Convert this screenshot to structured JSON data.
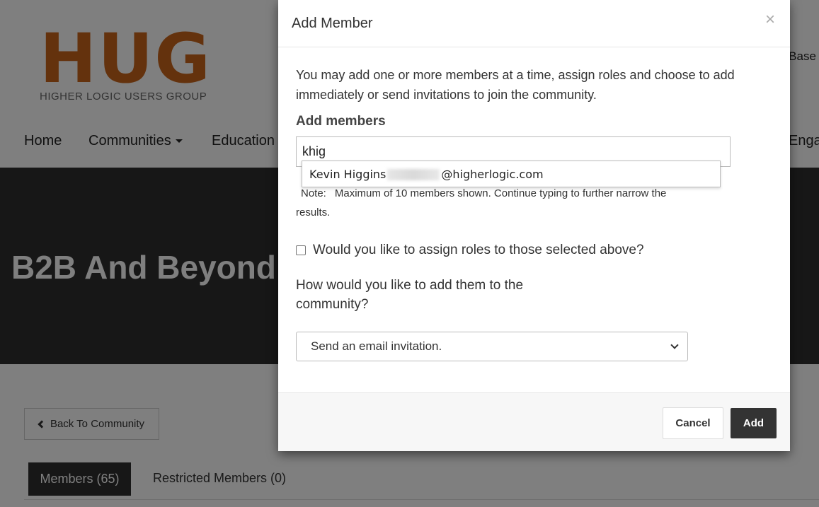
{
  "background": {
    "logo": {
      "mark": "HUG",
      "subtitle": "HIGHER LOGIC USERS GROUP",
      "mark_color": "#c8651b"
    },
    "top_right_link": "e Base",
    "nav": [
      {
        "label": "Home"
      },
      {
        "label": "Communities",
        "has_caret": true
      },
      {
        "label": "Education"
      },
      {
        "label": "Enga"
      }
    ],
    "banner_title": "B2B And Beyond -",
    "back_button": "Back To Community",
    "tabs": [
      {
        "label": "Members (65)",
        "active": true
      },
      {
        "label": "Restricted Members (0)",
        "active": false
      }
    ]
  },
  "modal": {
    "title": "Add Member",
    "close": "×",
    "intro": "You may add one or more members at a time, assign roles and choose to add immediately or send invitations to join the community.",
    "add_members_label": "Add members",
    "input_value": "khig",
    "suggestion": {
      "name": "Kevin Higgins",
      "email_domain": "@higherlogic.com"
    },
    "note_label": "Note:",
    "note_text": "Maximum of 10 members shown. Continue typing to further narrow the results.",
    "roles_checkbox_label": "Would you like to assign roles to those selected above?",
    "roles_checked": false,
    "add_method_question": "How would you like to add them to the community?",
    "add_method_selected": "Send an email invitation.",
    "cancel_label": "Cancel",
    "add_label": "Add"
  },
  "colors": {
    "dark": "#2e2e2e",
    "accent": "#c8651b"
  }
}
